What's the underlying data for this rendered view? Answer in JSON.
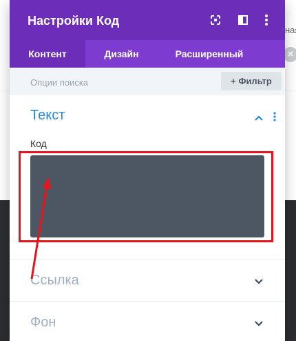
{
  "background": {
    "partial_text": "ная"
  },
  "modal": {
    "title": "Настройки Код",
    "header_icons": [
      "expand-icon",
      "sidebar-layout-icon",
      "more-vertical-icon"
    ],
    "tabs": [
      {
        "label": "Контент",
        "active": true
      },
      {
        "label": "Дизайн",
        "active": false
      },
      {
        "label": "Расширенный",
        "active": false
      }
    ],
    "search": {
      "placeholder": "Опции поиска",
      "filter_label": "+ Фильтр"
    },
    "sections": [
      {
        "title": "Текст",
        "expanded": true
      },
      {
        "title": "Ссылка",
        "expanded": false
      },
      {
        "title": "Фон",
        "expanded": false
      }
    ],
    "code_field": {
      "label": "Код",
      "value": ""
    }
  },
  "colors": {
    "header": "#6c2eb9",
    "tabs_bar": "#7e3bd0",
    "accent_blue": "#2b87da",
    "code_bg": "#4d5764",
    "annotation_red": "#e8141c"
  }
}
